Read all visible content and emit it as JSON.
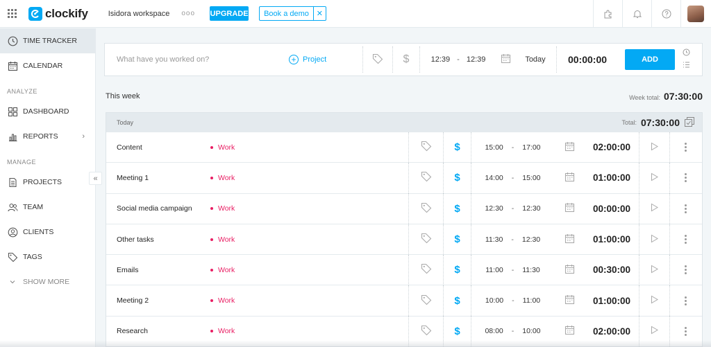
{
  "topbar": {
    "logo_text": "clockify",
    "workspace": "Isidora workspace",
    "more_dots": "ooo",
    "upgrade_label": "UPGRADE",
    "demo_label": "Book a demo",
    "demo_close": "✕"
  },
  "sidebar": {
    "items_top": [
      {
        "label": "TIME TRACKER",
        "icon": "clock-icon",
        "active": true
      },
      {
        "label": "CALENDAR",
        "icon": "calendar-icon"
      }
    ],
    "analyze_label": "ANALYZE",
    "analyze_items": [
      {
        "label": "DASHBOARD",
        "icon": "dashboard-icon"
      },
      {
        "label": "REPORTS",
        "icon": "reports-icon",
        "chevron": "›"
      }
    ],
    "manage_label": "MANAGE",
    "manage_items": [
      {
        "label": "PROJECTS",
        "icon": "document-icon"
      },
      {
        "label": "TEAM",
        "icon": "team-icon"
      },
      {
        "label": "CLIENTS",
        "icon": "clients-icon"
      },
      {
        "label": "TAGS",
        "icon": "tag-icon"
      }
    ],
    "show_more": "SHOW MORE",
    "collapse_glyph": "«"
  },
  "timer": {
    "placeholder": "What have you worked on?",
    "project_label": "Project",
    "start": "12:39",
    "end": "12:39",
    "dash": "-",
    "date": "Today",
    "duration": "00:00:00",
    "add_label": "ADD",
    "currency_symbol": "$"
  },
  "week": {
    "label": "This week",
    "total_label": "Week total:",
    "total": "07:30:00"
  },
  "day": {
    "label": "Today",
    "total_label": "Total:",
    "total": "07:30:00"
  },
  "entries": [
    {
      "description": "Content",
      "project": "Work",
      "start": "15:00",
      "end": "17:00",
      "duration": "02:00:00"
    },
    {
      "description": "Meeting 1",
      "project": "Work",
      "start": "14:00",
      "end": "15:00",
      "duration": "01:00:00"
    },
    {
      "description": "Social media campaign",
      "project": "Work",
      "start": "12:30",
      "end": "12:30",
      "duration": "00:00:00"
    },
    {
      "description": "Other tasks",
      "project": "Work",
      "start": "11:30",
      "end": "12:30",
      "duration": "01:00:00"
    },
    {
      "description": "Emails",
      "project": "Work",
      "start": "11:00",
      "end": "11:30",
      "duration": "00:30:00"
    },
    {
      "description": "Meeting 2",
      "project": "Work",
      "start": "10:00",
      "end": "11:00",
      "duration": "01:00:00"
    },
    {
      "description": "Research",
      "project": "Work",
      "start": "08:00",
      "end": "10:00",
      "duration": "02:00:00"
    }
  ],
  "colors": {
    "accent": "#03a9f4",
    "project": "#e91e63",
    "background": "#f2f6f8",
    "header_gray": "#e4eaee"
  }
}
